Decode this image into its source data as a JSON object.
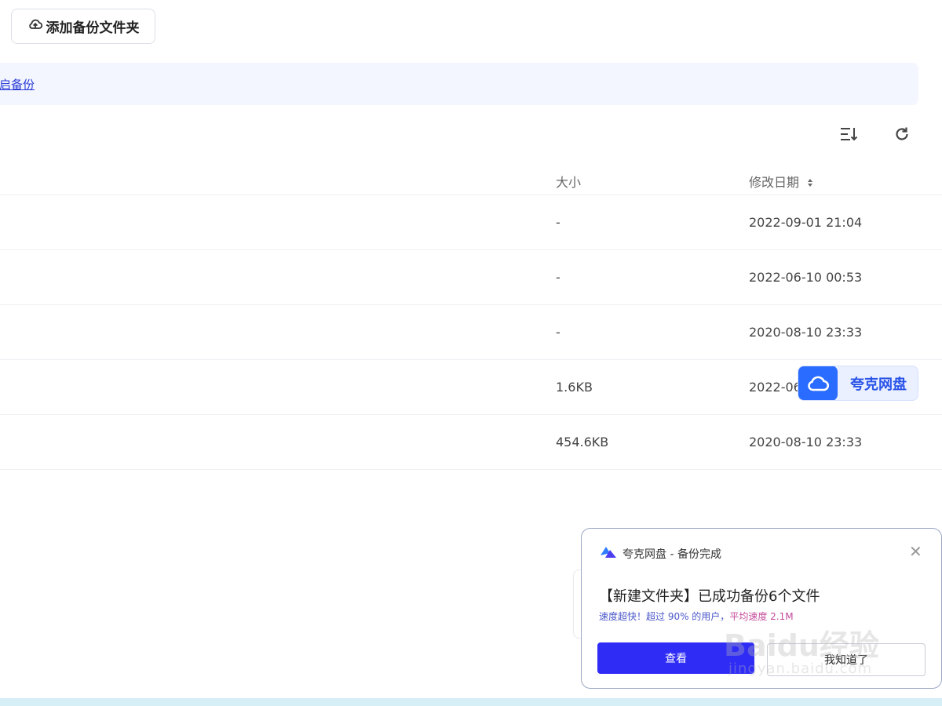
{
  "toolbar": {
    "add_folder_label": "添加备份文件夹"
  },
  "banner": {
    "link_text": "启备份"
  },
  "table": {
    "headers": {
      "size": "大小",
      "date": "修改日期"
    },
    "rows": [
      {
        "size": "-",
        "date": "2022-09-01 21:04"
      },
      {
        "size": "-",
        "date": "2022-06-10 00:53"
      },
      {
        "size": "-",
        "date": "2020-08-10 23:33"
      },
      {
        "size": "1.6KB",
        "date": "2022-06"
      },
      {
        "size": "454.6KB",
        "date": "2020-08-10 23:33"
      }
    ]
  },
  "float_widget": {
    "label": "夸克网盘"
  },
  "toast": {
    "title": "夸克网盘 - 备份完成",
    "message": "【新建文件夹】已成功备份6个文件",
    "subtext_start": "速度超快！超过 90% 的用户，",
    "subtext_accent": "平均速度 2.1M",
    "view_button": "查看",
    "ok_button": "我知道了"
  },
  "watermark": {
    "brand": "Baidu经验",
    "url": "jingyan.baidu.com"
  },
  "colors": {
    "accent": "#2f2cf5",
    "brand_blue": "#2a6cff",
    "banner_bg": "#f3f6ff"
  }
}
